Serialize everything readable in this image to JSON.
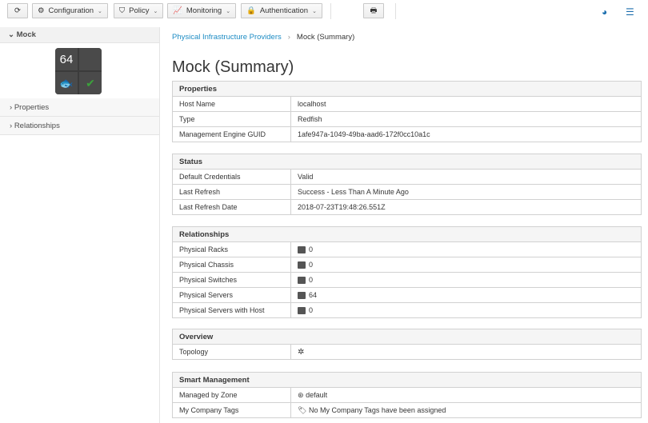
{
  "toolbar": {
    "configuration": "Configuration",
    "policy": "Policy",
    "monitoring": "Monitoring",
    "authentication": "Authentication"
  },
  "sidebar": {
    "title": "Mock",
    "quad_count": "64",
    "items": [
      "Properties",
      "Relationships"
    ]
  },
  "breadcrumb": {
    "parent": "Physical Infrastructure Providers",
    "current": "Mock (Summary)"
  },
  "page_title": "Mock (Summary)",
  "properties": {
    "header": "Properties",
    "rows": [
      [
        "Host Name",
        "localhost"
      ],
      [
        "Type",
        "Redfish"
      ],
      [
        "Management Engine GUID",
        "1afe947a-1049-49ba-aad6-172f0cc10a1c"
      ]
    ]
  },
  "status": {
    "header": "Status",
    "rows": [
      [
        "Default Credentials",
        "Valid"
      ],
      [
        "Last Refresh",
        "Success - Less Than A Minute Ago"
      ],
      [
        "Last Refresh Date",
        "2018-07-23T19:48:26.551Z"
      ]
    ]
  },
  "relationships": {
    "header": "Relationships",
    "rows": [
      [
        "Physical Racks",
        "0"
      ],
      [
        "Physical Chassis",
        "0"
      ],
      [
        "Physical Switches",
        "0"
      ],
      [
        "Physical Servers",
        "64"
      ],
      [
        "Physical Servers with Host",
        "0"
      ]
    ]
  },
  "overview": {
    "header": "Overview",
    "rows": [
      [
        "Topology",
        ""
      ]
    ]
  },
  "smart": {
    "header": "Smart Management",
    "rows": [
      [
        "Managed by Zone",
        "default"
      ],
      [
        "My Company Tags",
        "No My Company Tags have been assigned"
      ]
    ]
  }
}
